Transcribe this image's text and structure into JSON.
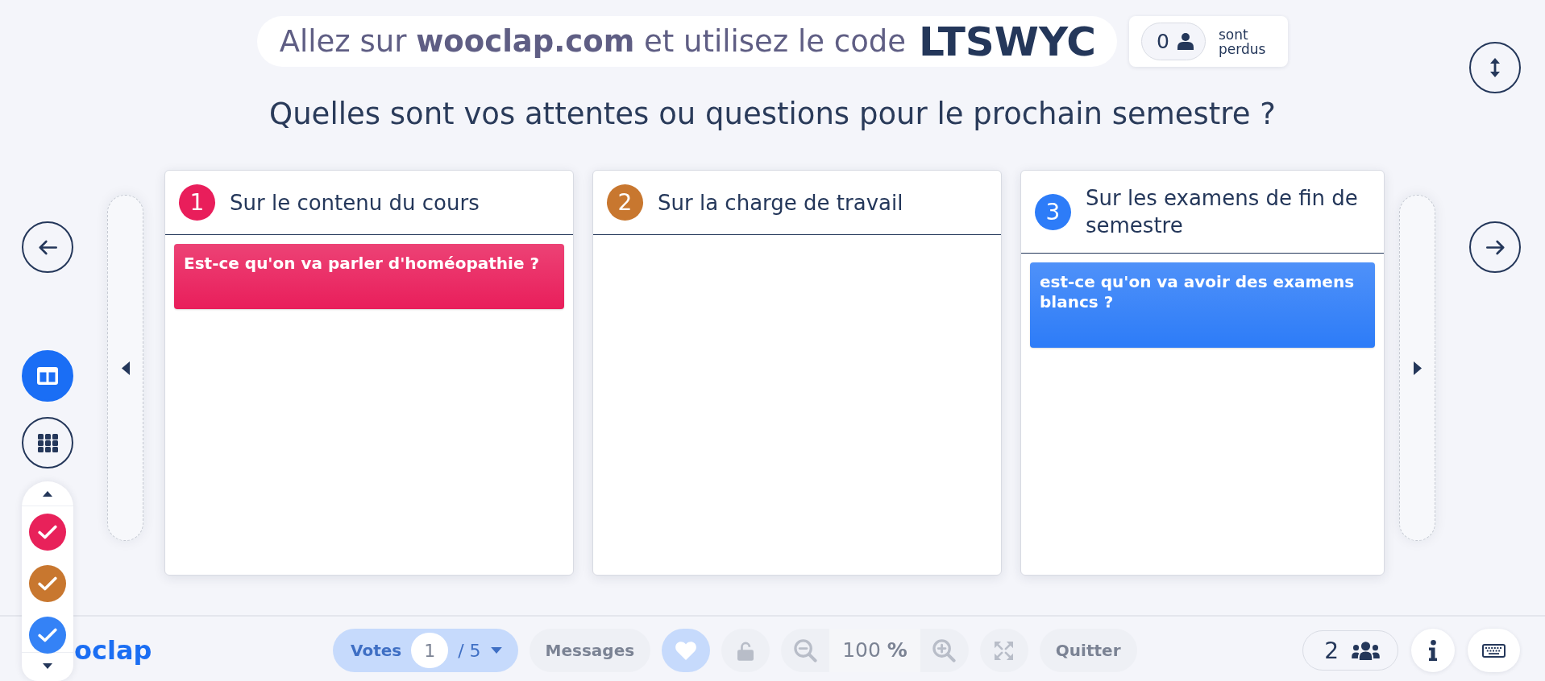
{
  "join": {
    "instructions": "Allez sur **wooclap.com** et utilisez le code",
    "code": "LTSWYC"
  },
  "lost": {
    "count": "0",
    "label": "sont perdus"
  },
  "question": "Quelles sont vos attentes ou questions pour le prochain semestre ?",
  "view_modes": [
    {
      "kind": "columns",
      "selected": true
    },
    {
      "kind": "grid",
      "selected": false
    }
  ],
  "color_filters": [
    {
      "color": "#e8215a",
      "checked": true
    },
    {
      "color": "#c8772f",
      "checked": true
    },
    {
      "color": "#3482f6",
      "checked": true
    }
  ],
  "columns": [
    {
      "number": "1",
      "title": "Sur le contenu du cours",
      "color": "#e91e5b",
      "answers": [
        "Est-ce qu'on va parler d'homéopathie ?"
      ]
    },
    {
      "number": "2",
      "title": "Sur la charge de travail",
      "color": "#c8772f"
    },
    {
      "number": "3",
      "title": "Sur les examens de fin de semestre",
      "color": "#2d7cf8",
      "answers": [
        "est-ce qu'on va avoir des examens blancs ?"
      ]
    }
  ],
  "bottom_bar": {
    "logo": "oclap",
    "tools": [
      {
        "kind": "votes",
        "label": "Votes",
        "current": "1",
        "total": "/ 5",
        "disabled": true
      },
      {
        "kind": "text",
        "label": "Messages",
        "disabled": true
      },
      {
        "kind": "like",
        "disabled": true
      },
      {
        "kind": "lock",
        "disabled": true
      },
      {
        "kind": "zoom",
        "value": "100 **%**",
        "disabled": true
      },
      {
        "kind": "fullscreen",
        "disabled": true
      },
      {
        "kind": "text",
        "label": "Quitter",
        "disabled": true
      }
    ],
    "participants": "2"
  }
}
